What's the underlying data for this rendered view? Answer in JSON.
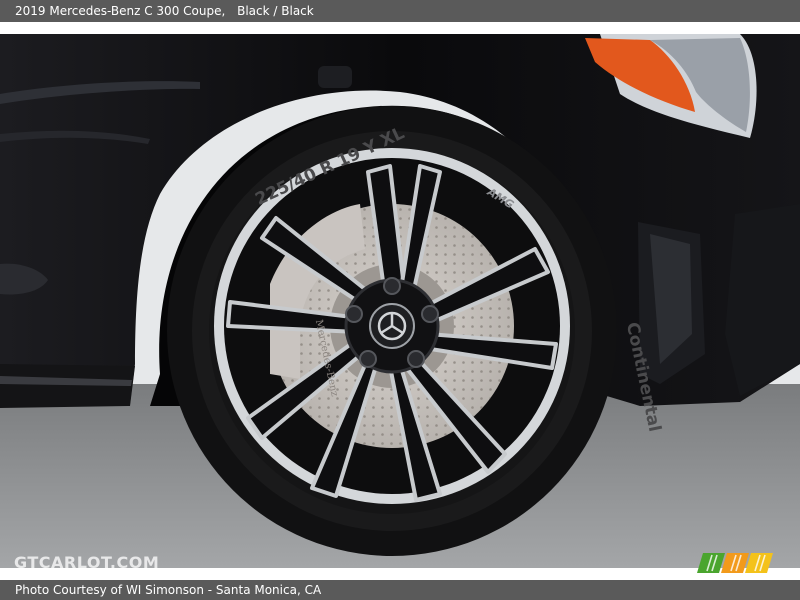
{
  "caption": {
    "title": "2019 Mercedes-Benz C 300 Coupe,",
    "colors": "Black / Black"
  },
  "photo": {
    "tire_sidewall_size": "225/40 R 19 Y XL",
    "tire_brand": "Continental",
    "wheel_badge": "AMG",
    "caliper_text": "Mercedes-Benz",
    "colors": {
      "paint": "#0b0b0d",
      "floor": "#8a8c8e",
      "wall": "#e6e8ea",
      "rim_edge": "#cfd2d5",
      "caliper": "#c9c4c0",
      "indicator": "#e2581d"
    }
  },
  "watermark": "GTCARLOT.COM",
  "credit": "Photo Courtesy of WI Simonson - Santa Monica, CA",
  "logo": {
    "icon": "gtcarlot-logo-icon",
    "colors": [
      "#4aa52e",
      "#f29a1b",
      "#f4c21a"
    ]
  }
}
